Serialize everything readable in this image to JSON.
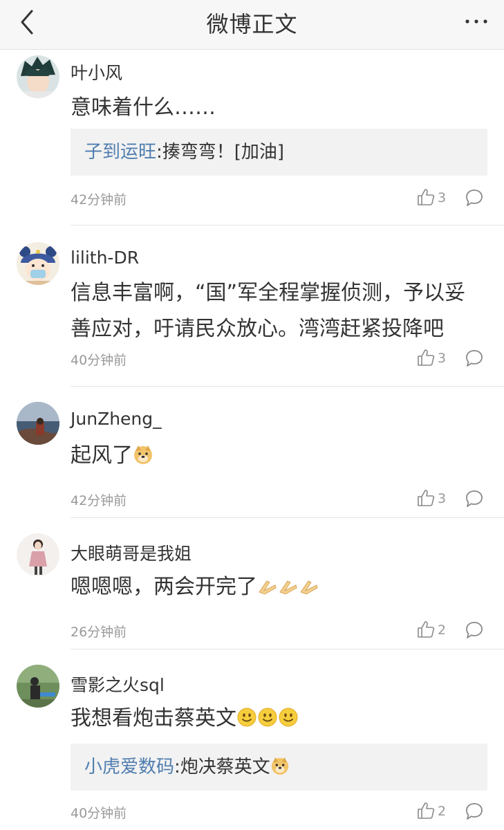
{
  "header": {
    "title": "微博正文",
    "back_icon": "chevron-left-icon",
    "more_icon": "more-dots-icon"
  },
  "comments": [
    {
      "username": "叶小风",
      "text": "意味着什么……",
      "reply": {
        "user": "子到运旺",
        "text": ":揍弯弯！[加油]"
      },
      "time": "42分钟前",
      "likes": "3"
    },
    {
      "username": "lilith-DR",
      "text_line1": "信息丰富啊，“国”军全程掌握侦测，予以妥",
      "text_line2": "善应对，吁请民众放心。湾湾赶紧投降吧",
      "time": "40分钟前",
      "likes": "3"
    },
    {
      "username": "JunZheng_",
      "text": "起风了",
      "emojis": [
        "doge-emoji"
      ],
      "time": "42分钟前",
      "likes": "3"
    },
    {
      "username": "大眼萌哥是我姐",
      "text": "嗯嗯嗯，两会开完了",
      "emojis": [
        "clap-emoji",
        "clap-emoji",
        "clap-emoji"
      ],
      "time": "26分钟前",
      "likes": "2"
    },
    {
      "username": "雪影之火sql",
      "text": "我想看炮击蔡英文",
      "emojis": [
        "smile-emoji",
        "smile-emoji",
        "smile-emoji"
      ],
      "reply": {
        "user": "小虎爱数码",
        "text": ":炮决蔡英文",
        "emoji": "doge-emoji"
      },
      "time": "40分钟前",
      "likes": "2"
    }
  ],
  "colors": {
    "link": "#507daf",
    "meta": "#999999",
    "reply_bg": "#f2f2f2"
  }
}
